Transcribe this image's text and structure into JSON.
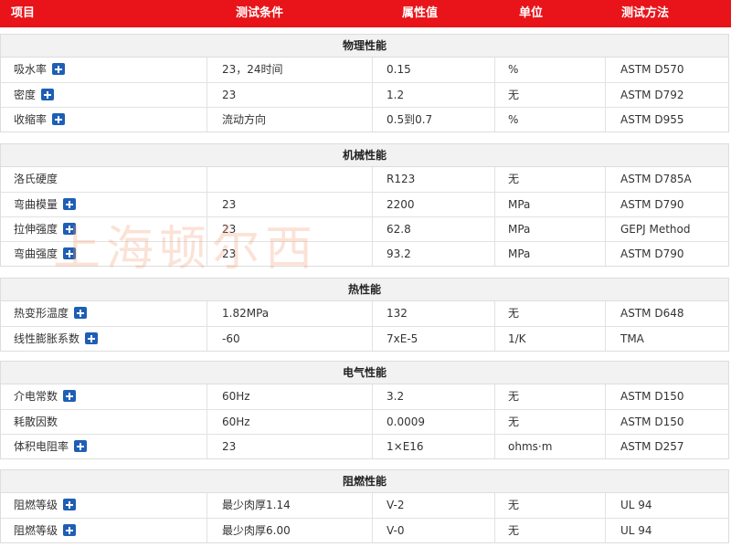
{
  "header": {
    "item": "项目",
    "condition": "测试条件",
    "value": "属性值",
    "unit": "单位",
    "method": "测试方法"
  },
  "sections": [
    {
      "title": "物理性能",
      "rows": [
        {
          "name": "吸水率",
          "plus": true,
          "condition": "23，24时间",
          "value": "0.15",
          "unit": "%",
          "method": "ASTM D570"
        },
        {
          "name": "密度",
          "plus": true,
          "condition": "23",
          "value": "1.2",
          "unit": "无",
          "method": "ASTM D792"
        },
        {
          "name": "收缩率",
          "plus": true,
          "condition": "流动方向",
          "value": "0.5到0.7",
          "unit": "%",
          "method": "ASTM D955"
        }
      ]
    },
    {
      "title": "机械性能",
      "rows": [
        {
          "name": "洛氏硬度",
          "plus": false,
          "condition": "",
          "value": "R123",
          "unit": "无",
          "method": "ASTM D785A"
        },
        {
          "name": "弯曲模量",
          "plus": true,
          "condition": "23",
          "value": "2200",
          "unit": "MPa",
          "method": "ASTM D790"
        },
        {
          "name": "拉伸强度",
          "plus": true,
          "condition": "23",
          "value": "62.8",
          "unit": "MPa",
          "method": "GEPJ Method"
        },
        {
          "name": "弯曲强度",
          "plus": true,
          "condition": "23",
          "value": "93.2",
          "unit": "MPa",
          "method": "ASTM D790"
        }
      ]
    },
    {
      "title": "热性能",
      "rows": [
        {
          "name": "热变形温度",
          "plus": true,
          "condition": "1.82MPa",
          "value": "132",
          "unit": "无",
          "method": "ASTM D648"
        },
        {
          "name": "线性膨胀系数",
          "plus": true,
          "condition": "-60",
          "value": "7xE-5",
          "unit": "1/K",
          "method": "TMA"
        }
      ]
    },
    {
      "title": "电气性能",
      "rows": [
        {
          "name": "介电常数",
          "plus": true,
          "condition": "60Hz",
          "value": "3.2",
          "unit": "无",
          "method": "ASTM D150"
        },
        {
          "name": "耗散因数",
          "plus": false,
          "condition": "60Hz",
          "value": "0.0009",
          "unit": "无",
          "method": "ASTM D150"
        },
        {
          "name": "体积电阻率",
          "plus": true,
          "condition": "23",
          "value": "1×E16",
          "unit": "ohms·m",
          "method": "ASTM D257"
        }
      ]
    },
    {
      "title": "阻燃性能",
      "rows": [
        {
          "name": "阻燃等级",
          "plus": true,
          "condition": "最少肉厚1.14",
          "value": "V-2",
          "unit": "无",
          "method": "UL 94"
        },
        {
          "name": "阻燃等级",
          "plus": true,
          "condition": "最少肉厚6.00",
          "value": "V-0",
          "unit": "无",
          "method": "UL 94"
        }
      ]
    }
  ],
  "watermark": "上海顿尔西",
  "colors": {
    "header_bg": "#e8141a",
    "plus_icon": "#1e5fb5"
  }
}
